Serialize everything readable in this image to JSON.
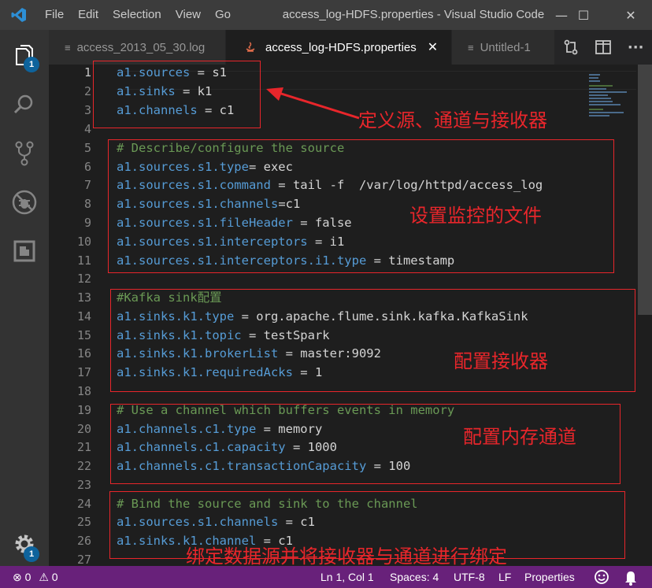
{
  "menu": [
    "File",
    "Edit",
    "Selection",
    "View",
    "Go"
  ],
  "window_title": "access_log-HDFS.properties - Visual Studio Code",
  "window_controls": {
    "minimize": "—",
    "maximize": "☐",
    "close": "✕"
  },
  "activity": {
    "explorer_badge": "1",
    "settings_badge": "1"
  },
  "tabs": [
    {
      "label": "access_2013_05_30.log",
      "active": false
    },
    {
      "label": "access_log-HDFS.properties",
      "active": true,
      "close": "✕"
    },
    {
      "label": "Untitled-1",
      "active": false
    }
  ],
  "editor_actions": {
    "more": "···"
  },
  "line_numbers": [
    "1",
    "2",
    "3",
    "4",
    "5",
    "6",
    "7",
    "8",
    "9",
    "10",
    "11",
    "12",
    "13",
    "14",
    "15",
    "16",
    "17",
    "18",
    "19",
    "20",
    "21",
    "22",
    "23",
    "24",
    "25",
    "26",
    "27"
  ],
  "code": {
    "l1": {
      "key": "a1.sources",
      "rest": " = s1"
    },
    "l2": {
      "key": "a1.sinks",
      "rest": " = k1"
    },
    "l3": {
      "key": "a1.channels",
      "rest": " = c1"
    },
    "l5": {
      "comment": "# Describe/configure the source"
    },
    "l6": {
      "key": "a1.sources.s1.type",
      "rest": "= exec"
    },
    "l7": {
      "key": "a1.sources.s1.command",
      "rest": " = tail -f  /var/log/httpd/access_log"
    },
    "l8": {
      "key": "a1.sources.s1.channels",
      "rest": "=c1"
    },
    "l9": {
      "key": "a1.sources.s1.fileHeader",
      "rest": " = false"
    },
    "l10": {
      "key": "a1.sources.s1.interceptors",
      "rest": " = i1"
    },
    "l11": {
      "key": "a1.sources.s1.interceptors.i1.type",
      "rest": " = timestamp"
    },
    "l13": {
      "comment": "#Kafka sink配置"
    },
    "l14": {
      "key": "a1.sinks.k1.type",
      "rest": " = org.apache.flume.sink.kafka.KafkaSink"
    },
    "l15": {
      "key": "a1.sinks.k1.topic",
      "rest": " = testSpark"
    },
    "l16": {
      "key": "a1.sinks.k1.brokerList",
      "rest": " = master:9092"
    },
    "l17": {
      "key": "a1.sinks.k1.requiredAcks",
      "rest": " = 1"
    },
    "l19": {
      "comment": "# Use a channel which buffers events in memory"
    },
    "l20": {
      "key": "a1.channels.c1.type",
      "rest": " = memory"
    },
    "l21": {
      "key": "a1.channels.c1.capacity",
      "rest": " = 1000"
    },
    "l22": {
      "key": "a1.channels.c1.transactionCapacity",
      "rest": " = 100"
    },
    "l24": {
      "comment": "# Bind the source and sink to the channel"
    },
    "l25": {
      "key": "a1.sources.s1.channels",
      "rest": " = c1"
    },
    "l26": {
      "key": "a1.sinks.k1.channel",
      "rest": " = c1"
    }
  },
  "annotations": {
    "define": "定义源、通道与接收器",
    "monitor": "设置监控的文件",
    "sink": "配置接收器",
    "channel": "配置内存通道",
    "bind": "绑定数据源并将接收器与通道进行绑定"
  },
  "annotation_color": "#e8262b",
  "status": {
    "errors": "0",
    "warnings": "0",
    "position": "Ln 1, Col 1",
    "spaces": "Spaces: 4",
    "encoding": "UTF-8",
    "eol": "LF",
    "language": "Properties"
  },
  "colors": {
    "status_bar": "#68217a",
    "keyword": "#569cd6",
    "comment": "#6a9955",
    "badge": "#0e639c"
  }
}
